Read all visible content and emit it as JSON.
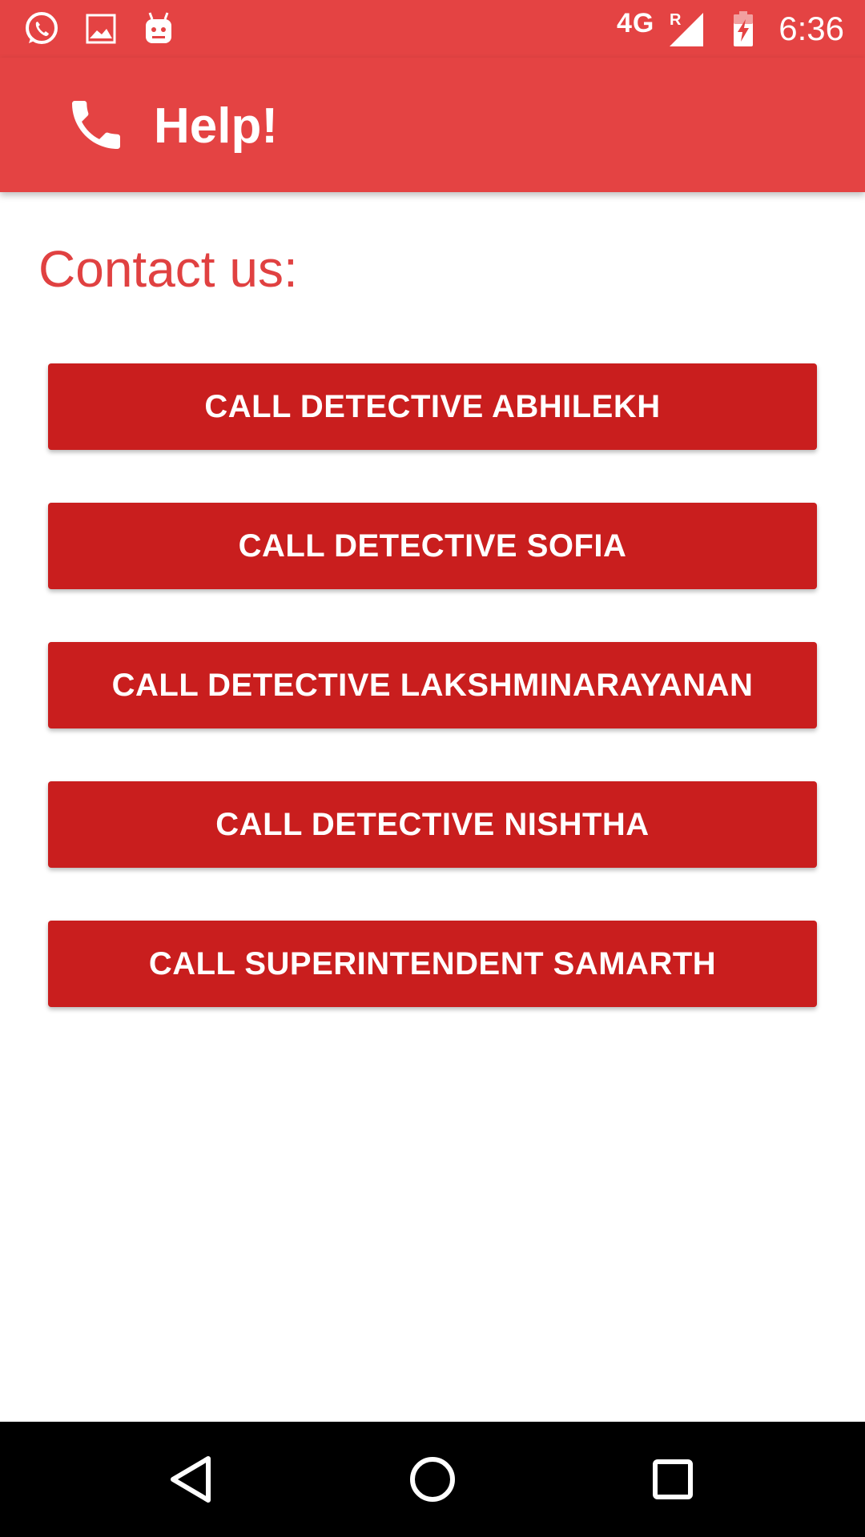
{
  "status_bar": {
    "network": "4G",
    "roaming": "R",
    "time": "6:36",
    "icons": [
      "whatsapp-icon",
      "image-icon",
      "android-icon",
      "signal-icon",
      "battery-charging-icon"
    ]
  },
  "app_bar": {
    "title": "Help!",
    "icon": "phone-icon"
  },
  "main": {
    "heading": "Contact us:",
    "buttons": [
      {
        "label": "CALL DETECTIVE ABHILEKH"
      },
      {
        "label": "CALL DETECTIVE SOFIA"
      },
      {
        "label": "CALL DETECTIVE LAKSHMINARAYANAN"
      },
      {
        "label": "CALL DETECTIVE NISHTHA"
      },
      {
        "label": "CALL SUPERINTENDENT SAMARTH"
      }
    ]
  },
  "nav_bar": {
    "icons": [
      "back-icon",
      "home-icon",
      "recents-icon"
    ]
  },
  "colors": {
    "app_bar": "#e44343",
    "button": "#c91e1e",
    "heading": "#e04141",
    "nav_bar": "#000000"
  }
}
